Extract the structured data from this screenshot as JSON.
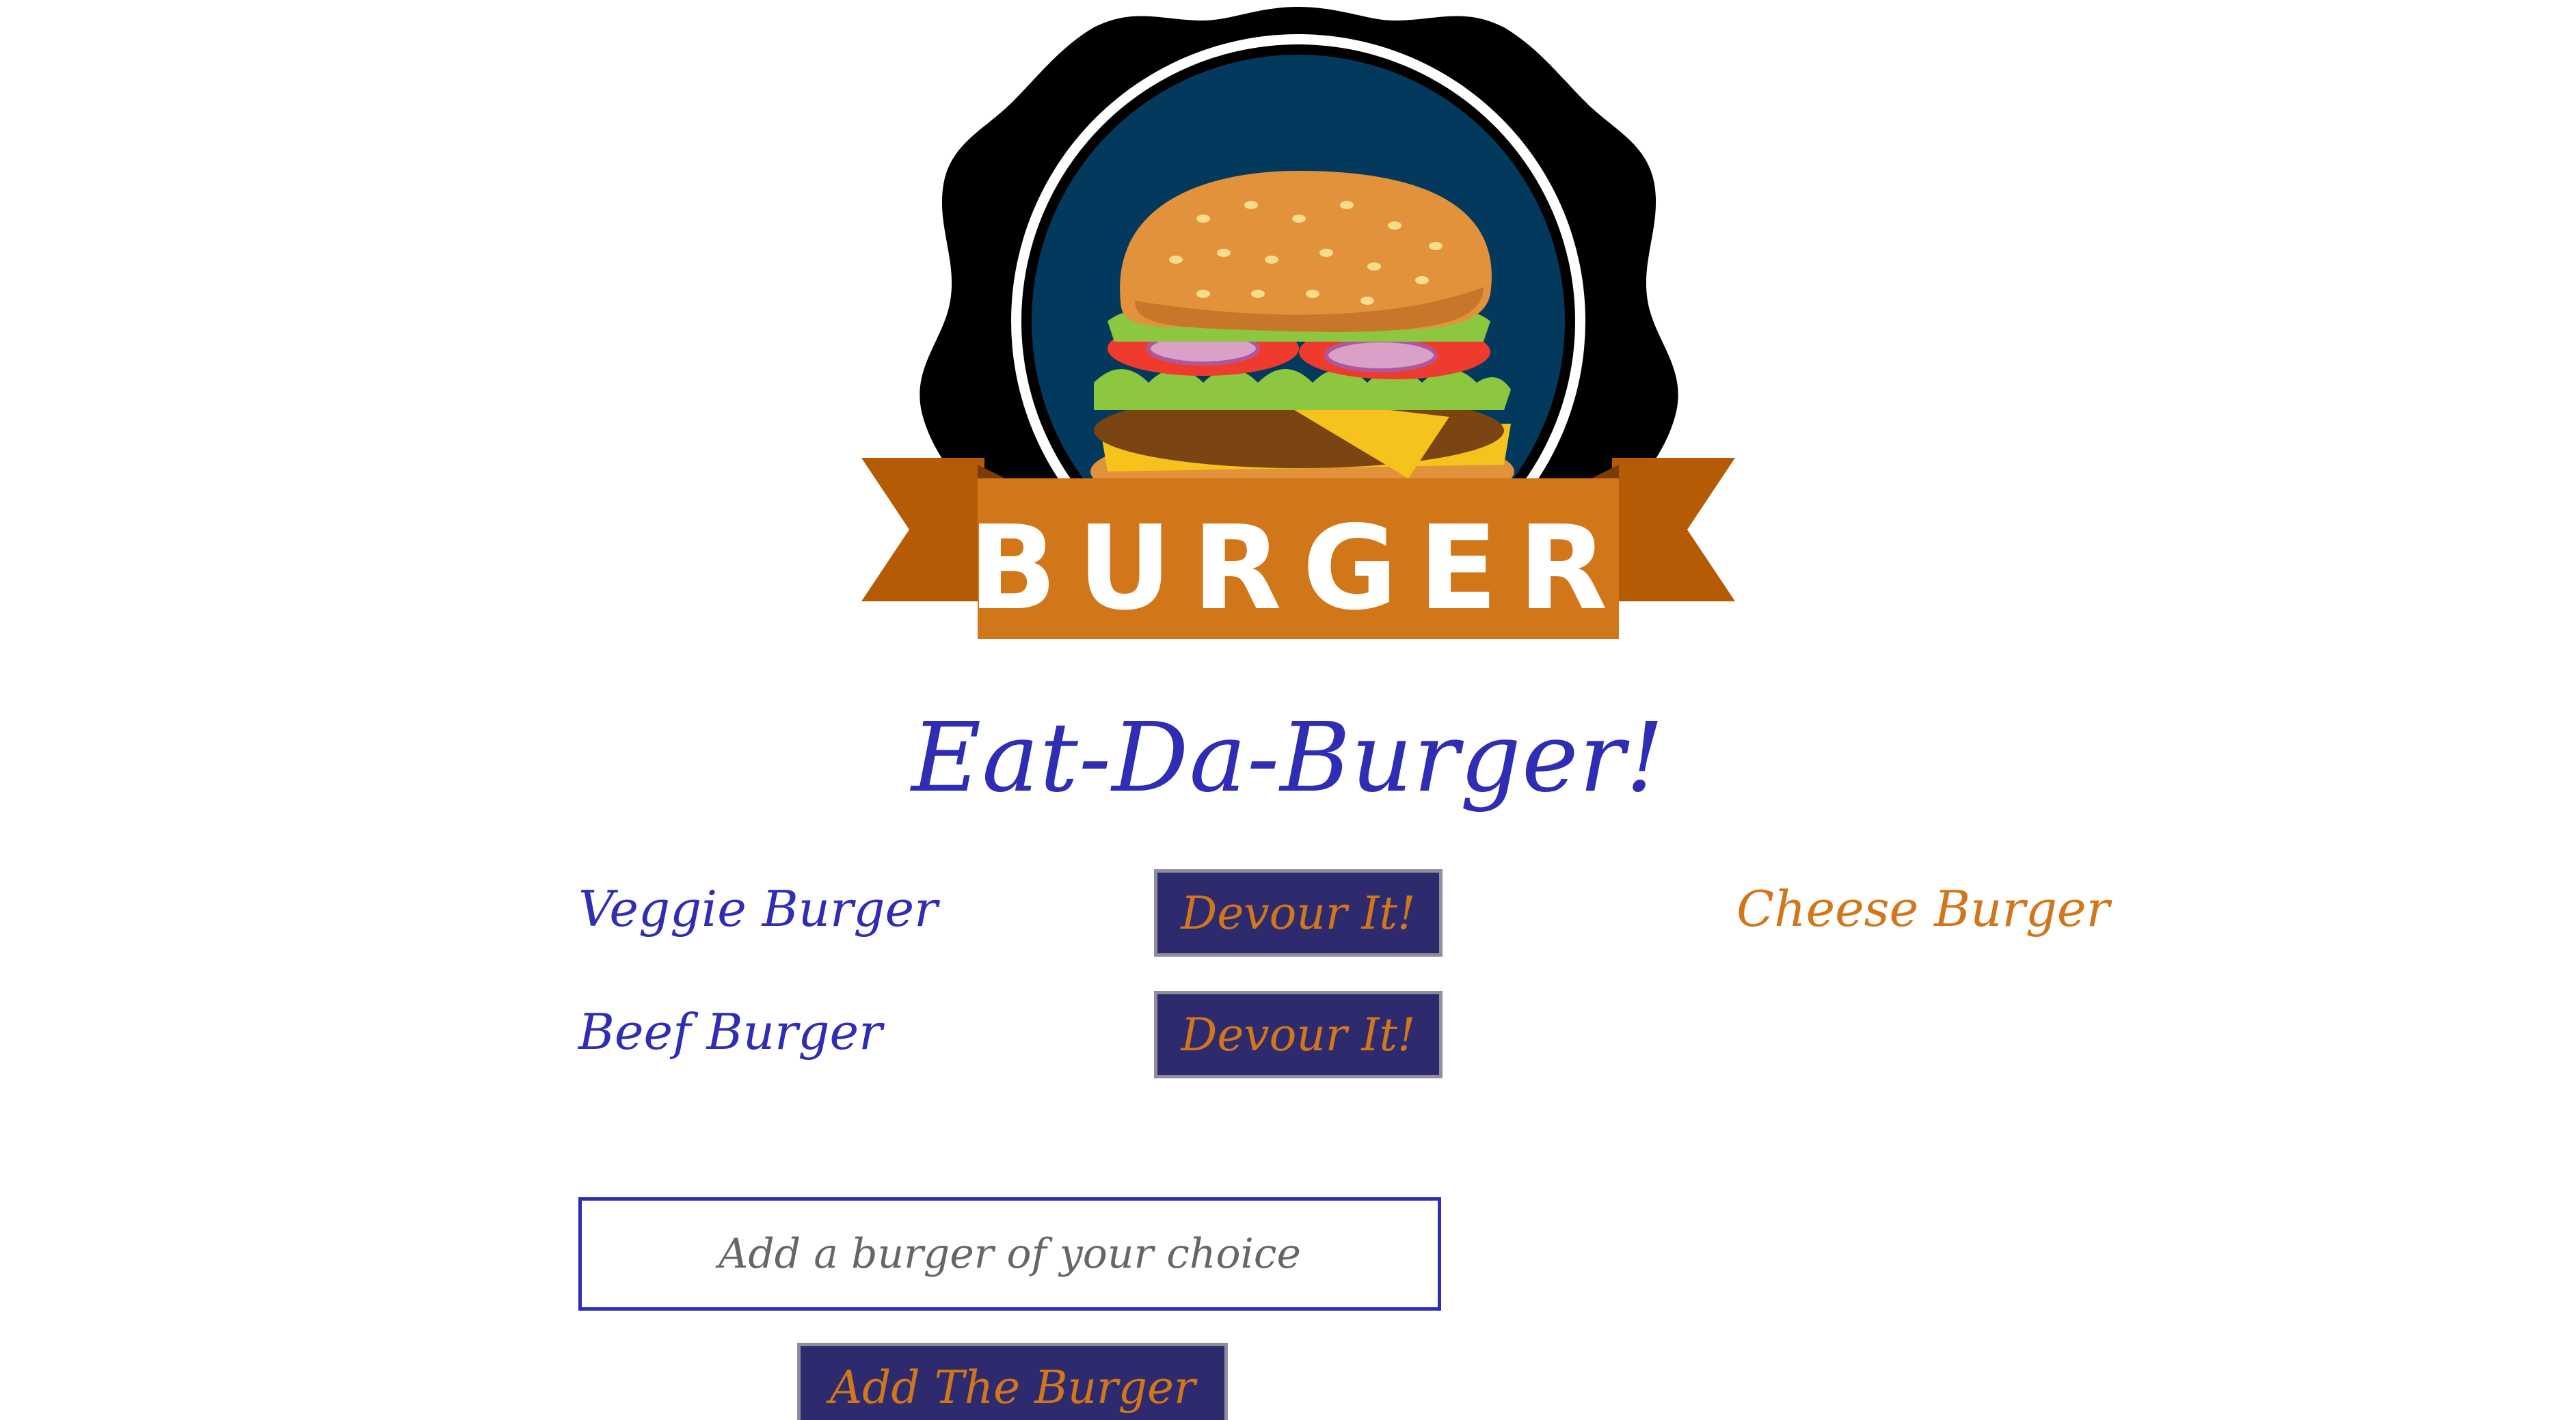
{
  "header": {
    "logo_text": "BURGER",
    "title": "Eat-Da-Burger!"
  },
  "burgers_to_eat": [
    {
      "name": "Veggie Burger",
      "button_label": "Devour It!"
    },
    {
      "name": "Beef Burger",
      "button_label": "Devour It!"
    }
  ],
  "burgers_devoured": [
    {
      "name": "Cheese Burger"
    }
  ],
  "form": {
    "input_placeholder": "Add a burger of your choice",
    "input_value": "",
    "submit_label": "Add The Burger"
  },
  "colors": {
    "title_text": "#2f2db3",
    "devoured_text": "#d2761a",
    "button_bg": "#2d2a6e",
    "button_text": "#d2761a",
    "ribbon": "#d2761a",
    "badge_bg": "#04395e"
  }
}
